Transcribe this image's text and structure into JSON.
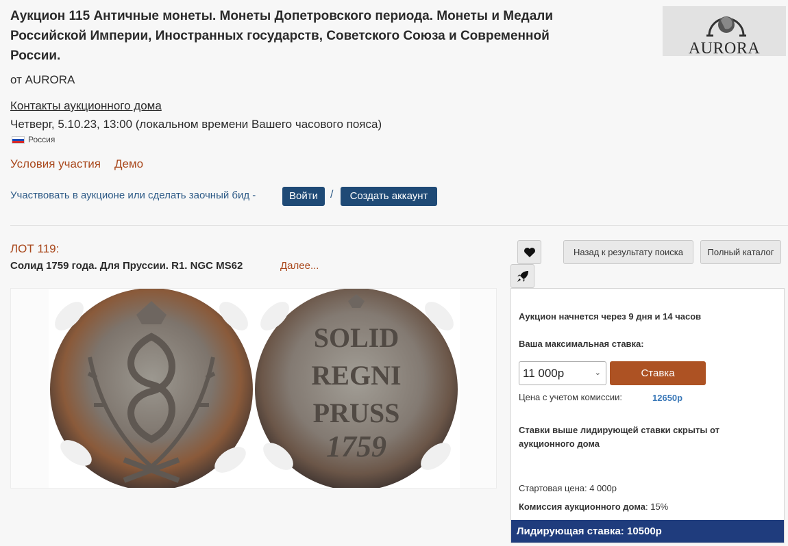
{
  "header": {
    "title": "Аукцион 115 Античные монеты. Монеты Допетровского периода. Монеты и Медали Российской Империи, Иностранных государств, Советского Союза и Современной России.",
    "from": "от AURORA",
    "contacts_link": "Контакты аукционного дома",
    "date": "Четверг, 5.10.23, 13:00 (локальном времени Вашего часового пояса)",
    "country": "Россия",
    "logo_text": "AURORA"
  },
  "links": {
    "terms": "Условия участия",
    "demo": "Демо"
  },
  "participation": {
    "text": "Участвовать в аукционе или сделать заочный бид -",
    "login_label": "Войти",
    "separator": "/",
    "create_account_label": "Создать аккаунт"
  },
  "lot": {
    "number": "ЛОТ 119:",
    "title": "Солид 1759 года. Для Пруссии. R1. NGC MS62",
    "more_link": "Далее..."
  },
  "navigation": {
    "back_label": "Назад к результату поиска",
    "catalog_label": "Полный каталог"
  },
  "icons": {
    "favorite": "heart-icon",
    "share": "rocket-icon"
  },
  "coin_legend": [
    "SOLID",
    "REGNI",
    "PRUSS",
    "1759"
  ],
  "bid": {
    "status": "Аукцион начнется через 9 дня и 14 часов",
    "max_label": "Ваша максимальная ставка:",
    "selected_amount": "11 000р",
    "bid_button": "Ставка",
    "commission_price_label": "Цена с учетом комиссии:",
    "commission_price_value": "12650р",
    "hidden_notice": "Ставки выше лидирующей ставки скрыты от аукционного дома",
    "start_price": "Стартовая цена: 4 000р",
    "house_commission_label": "Комиссия аукционного дома",
    "house_commission_value": ": 15%",
    "leading_bid": "Лидирующая ставка: 10500р"
  },
  "colors": {
    "accent": "#a9481c",
    "primary_button": "#1f4a76",
    "bid_button": "#ad5223",
    "leading_bar": "#1f3c7d",
    "link_blue": "#3a78b8"
  }
}
